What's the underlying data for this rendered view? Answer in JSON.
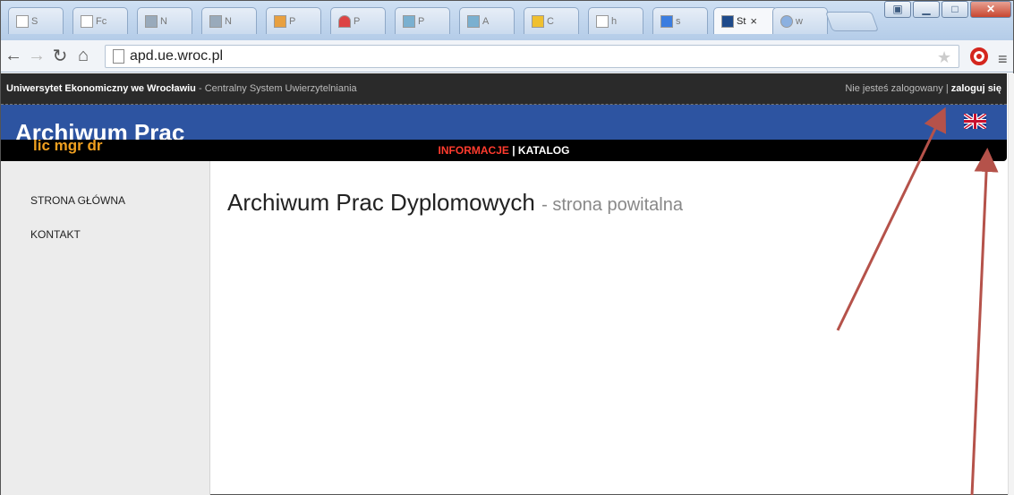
{
  "browser": {
    "tabs": [
      {
        "label": "S",
        "active": false
      },
      {
        "label": "Fc",
        "active": false
      },
      {
        "label": "N",
        "active": false
      },
      {
        "label": "N",
        "active": false
      },
      {
        "label": "P",
        "active": false
      },
      {
        "label": "P",
        "active": false
      },
      {
        "label": "P",
        "active": false
      },
      {
        "label": "A",
        "active": false
      },
      {
        "label": "C",
        "active": false
      },
      {
        "label": "h",
        "active": false
      },
      {
        "label": "s",
        "active": false
      },
      {
        "label": "St",
        "active": true
      },
      {
        "label": "w",
        "active": false
      }
    ],
    "tab_close_glyph": "×",
    "url": "apd.ue.wroc.pl"
  },
  "site": {
    "topbar": {
      "org": "Uniwersytet Ekonomiczny we Wrocławiu",
      "system": "- Centralny System Uwierzytelniania",
      "login_status": "Nie jesteś zalogowany |",
      "login_link": "zaloguj się"
    },
    "title": "Archiwum Prac",
    "degrees": "lic mgr dr",
    "nav": {
      "informacje": "INFORMACJE",
      "separator": "|",
      "katalog": "KATALOG"
    },
    "sidebar": [
      {
        "label": "STRONA GŁÓWNA"
      },
      {
        "label": "KONTAKT"
      }
    ],
    "heading": {
      "main": "Archiwum Prac Dyplomowych",
      "sub": "- strona powitalna"
    },
    "colors": {
      "banner": "#2d54a1",
      "nav_active": "#ff3b2e",
      "degrees": "#f0a020",
      "annotation_arrow": "#b5524a"
    }
  }
}
